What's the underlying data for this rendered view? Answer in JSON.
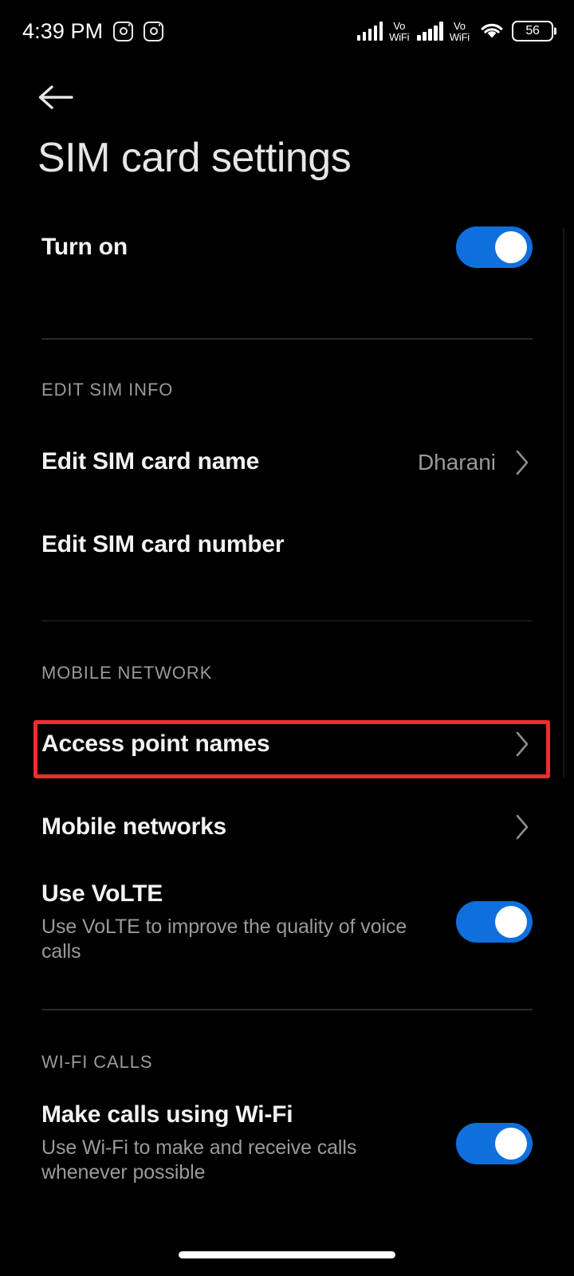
{
  "status_bar": {
    "time": "4:39 PM",
    "notification_icons": [
      "instagram-icon",
      "instagram-icon"
    ],
    "signal_1": {
      "icon": "signal-bars-icon",
      "label_line1": "Vo",
      "label_line2": "WiFi"
    },
    "signal_2": {
      "icon": "signal-bars-icon",
      "label_line1": "Vo",
      "label_line2": "WiFi"
    },
    "wifi_icon": "wifi-icon",
    "battery_level": "56"
  },
  "header": {
    "back_icon": "back-arrow-icon",
    "title": "SIM card settings"
  },
  "sections": [
    {
      "id": "main",
      "header": null,
      "rows": [
        {
          "id": "turn-on",
          "primary": "Turn on",
          "secondary": null,
          "value": null,
          "control": "toggle",
          "toggle_on": true
        }
      ]
    },
    {
      "id": "edit-sim-info",
      "header": "EDIT SIM INFO",
      "rows": [
        {
          "id": "edit-sim-card-name",
          "primary": "Edit SIM card name",
          "secondary": null,
          "value": "Dharani",
          "control": "chevron",
          "toggle_on": null
        },
        {
          "id": "edit-sim-card-number",
          "primary": "Edit SIM card number",
          "secondary": null,
          "value": null,
          "control": "none",
          "toggle_on": null
        }
      ]
    },
    {
      "id": "mobile-network",
      "header": "MOBILE NETWORK",
      "rows": [
        {
          "id": "access-point-names",
          "primary": "Access point names",
          "secondary": null,
          "value": null,
          "control": "chevron",
          "toggle_on": null,
          "highlighted": true
        },
        {
          "id": "mobile-networks",
          "primary": "Mobile networks",
          "secondary": null,
          "value": null,
          "control": "chevron",
          "toggle_on": null
        },
        {
          "id": "use-volte",
          "primary": "Use VoLTE",
          "secondary": "Use VoLTE to improve the quality of voice calls",
          "value": null,
          "control": "toggle",
          "toggle_on": true
        }
      ]
    },
    {
      "id": "wifi-calls",
      "header": "WI-FI CALLS",
      "rows": [
        {
          "id": "make-calls-using-wifi",
          "primary": "Make calls using Wi-Fi",
          "secondary": "Use Wi-Fi to make and receive calls whenever possible",
          "value": null,
          "control": "toggle",
          "toggle_on": true
        }
      ]
    }
  ],
  "highlight": {
    "target": "access-point-names",
    "color": "#ee2d2d"
  },
  "colors": {
    "background": "#000000",
    "toggle_on": "#0f6fdd",
    "toggle_knob": "#ffffff",
    "primary_text": "#f2f2f2",
    "secondary_text": "#9a9a9a",
    "title_text": "#e6e6e6",
    "divider": "#292929"
  },
  "gesture_bar": "home-indicator"
}
